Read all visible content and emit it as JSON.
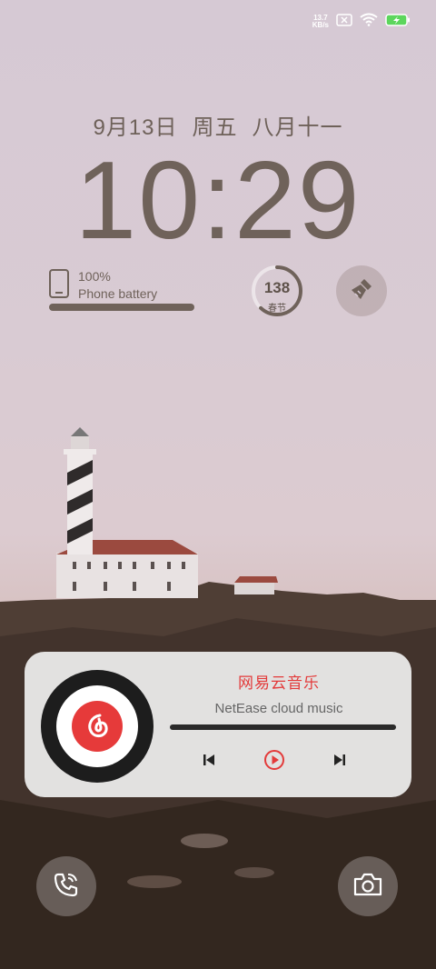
{
  "status_bar": {
    "net_speed_value": "13.7",
    "net_speed_unit": "KB/s",
    "icons": [
      "no-sim-icon",
      "wifi-icon",
      "battery-charging-icon"
    ]
  },
  "lockscreen": {
    "date": "9月13日",
    "weekday": "周五",
    "lunar_date": "八月十一",
    "time": "10:29"
  },
  "battery_widget": {
    "percent": "100%",
    "label": "Phone battery",
    "level": 1.0
  },
  "countdown_widget": {
    "days": "138",
    "event": "春节",
    "progress_fraction": 0.62
  },
  "clean_button": {
    "icon": "broom-icon"
  },
  "music_card": {
    "app_name": "网易云音乐",
    "track": "NetEase cloud music",
    "controls": [
      "previous-icon",
      "play-icon",
      "next-icon"
    ],
    "accent_color": "#e33a3a"
  },
  "shortcuts": {
    "left": "phone-icon",
    "right": "camera-icon"
  }
}
